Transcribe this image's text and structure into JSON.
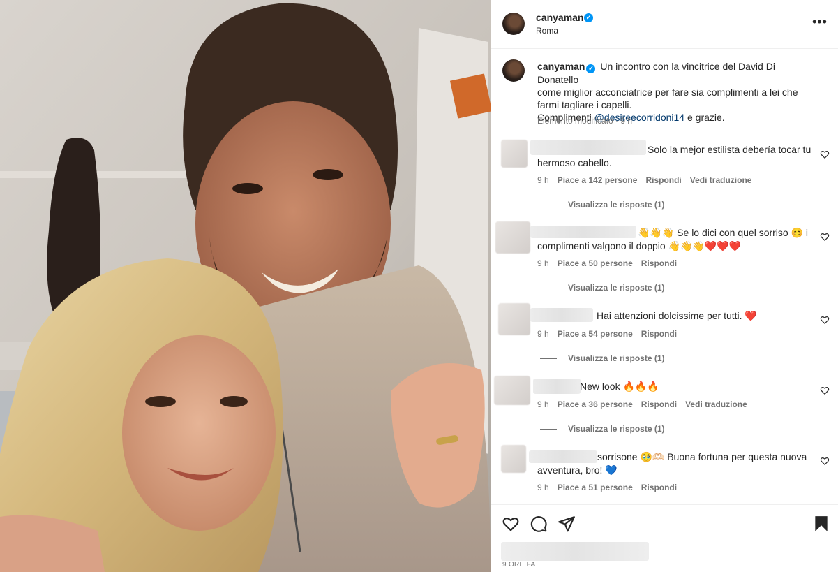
{
  "post": {
    "username": "canyaman",
    "location": "Roma",
    "more_label": "•••",
    "verified_glyph": "✓"
  },
  "caption": {
    "username": "canyaman",
    "text_before_mention": "Un incontro con la vincitrice del David Di Donatello come miglior acconciatrice per fare sia complimenti a lei che farmi tagliare i capelli. Compliment",
    "line1": "Un incontro con la vincitrice del David Di Donatello",
    "line2": "come miglior acconciatrice per fare sia complimenti a lei che",
    "line3": "farmi tagliare i capelli.",
    "line4_prefix": "Complimenti ",
    "mention": "@desireecorridoni14",
    "line4_suffix": " e grazie.",
    "meta": "Elemento modificato · 9 h"
  },
  "comments": [
    {
      "text": "Solo la mejor estilista debería tocar tu hermoso cabello.",
      "time": "9 h",
      "likes": "Piace a 142 persone",
      "reply": "Rispondi",
      "translate": "Vedi traduzione",
      "replies": "Visualizza le risposte (1)"
    },
    {
      "text": "👋👋👋 Se lo dici con quel sorriso 😊 i complimenti valgono il doppio 👋👋👋❤️❤️❤️",
      "time": "9 h",
      "likes": "Piace a 50 persone",
      "reply": "Rispondi",
      "replies": "Visualizza le risposte (1)"
    },
    {
      "text": "Hai attenzioni dolcissime per tutti. ❤️",
      "time": "9 h",
      "likes": "Piace a 54 persone",
      "reply": "Rispondi",
      "replies": "Visualizza le risposte (1)"
    },
    {
      "text": "New look 🔥🔥🔥",
      "time": "9 h",
      "likes": "Piace a 36 persone",
      "reply": "Rispondi",
      "translate": "Vedi traduzione",
      "replies": "Visualizza le risposte (1)"
    },
    {
      "text": "sorrisone 🥹🫶🏻 Buona fortuna per questa nuova avventura, bro! 💙",
      "time": "9 h",
      "likes": "Piace a 51 persone",
      "reply": "Rispondi"
    }
  ],
  "footer": {
    "time_ago": "9 ORE FA"
  },
  "icons": {
    "like": "heart-icon",
    "comment": "comment-icon",
    "share": "share-icon",
    "save": "bookmark-icon",
    "more": "more-dots-icon",
    "verified": "verified-badge-icon"
  },
  "colors": {
    "verified_blue": "#0095f6",
    "mention_blue": "#00376b",
    "secondary_text": "#737373",
    "divider": "#efefef"
  }
}
